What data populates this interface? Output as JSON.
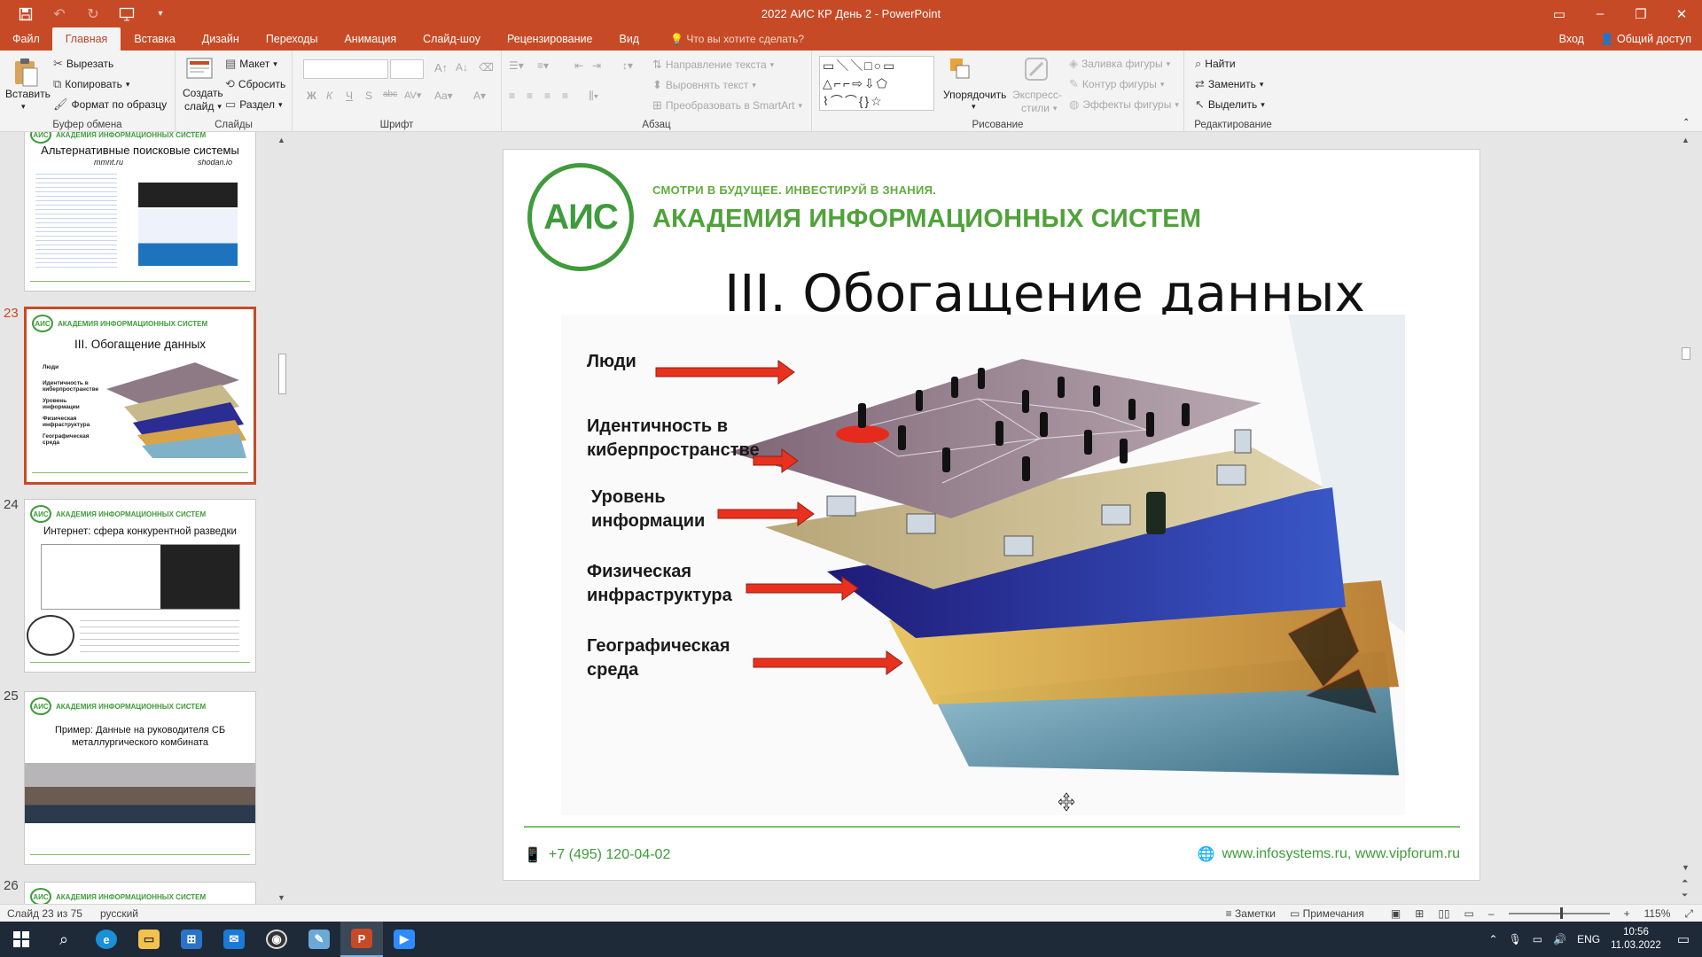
{
  "window": {
    "title": "2022 АИС КР День 2 - PowerPoint"
  },
  "tabs": [
    {
      "label": "Файл"
    },
    {
      "label": "Главная"
    },
    {
      "label": "Вставка"
    },
    {
      "label": "Дизайн"
    },
    {
      "label": "Переходы"
    },
    {
      "label": "Анимация"
    },
    {
      "label": "Слайд-шоу"
    },
    {
      "label": "Рецензирование"
    },
    {
      "label": "Вид"
    }
  ],
  "tell_me": "Что вы хотите сделать?",
  "account": {
    "signin": "Вход",
    "share": "Общий доступ"
  },
  "ribbon": {
    "clipboard": {
      "label": "Буфер обмена",
      "paste": "Вставить",
      "cut": "Вырезать",
      "copy": "Копировать",
      "format_painter": "Формат по образцу"
    },
    "slides": {
      "label": "Слайды",
      "new_slide_1": "Создать",
      "new_slide_2": "слайд",
      "layout": "Макет",
      "reset": "Сбросить",
      "section": "Раздел"
    },
    "font": {
      "label": "Шрифт",
      "font_name": "",
      "font_size": ""
    },
    "paragraph": {
      "label": "Абзац",
      "text_direction": "Направление текста",
      "align_text": "Выровнять текст",
      "smartart": "Преобразовать в SmartArt"
    },
    "drawing": {
      "label": "Рисование",
      "arrange": "Упорядочить",
      "quick_styles_1": "Экспресс-",
      "quick_styles_2": "стили",
      "shape_fill": "Заливка фигуры",
      "shape_outline": "Контур фигуры",
      "shape_effects": "Эффекты фигуры"
    },
    "editing": {
      "label": "Редактирование",
      "find": "Найти",
      "replace": "Заменить",
      "select": "Выделить"
    }
  },
  "thumbnails": [
    {
      "num": "",
      "title": "Альтернативные поисковые системы",
      "sub_left": "mmnt.ru",
      "sub_right": "shodan.io"
    },
    {
      "num": "23",
      "title": "III. Обогащение данных",
      "labels": [
        "Люди",
        "Идентичность в киберпространстве",
        "Уровень информации",
        "Физическая инфраструктура",
        "Географическая среда"
      ]
    },
    {
      "num": "24",
      "title": "Интернет: сфера конкурентной разведки"
    },
    {
      "num": "25",
      "title": "Пример: Данные на руководителя СБ металлургического комбината"
    },
    {
      "num": "26"
    }
  ],
  "slide": {
    "slogan": "СМОТРИ В БУДУЩЕЕ. ИНВЕСТИРУЙ В ЗНАНИЯ.",
    "academy": "АКАДЕМИЯ ИНФОРМАЦИОННЫХ СИСТЕМ",
    "logo_text": "АИС",
    "title": "III. Обогащение данных",
    "layers": [
      {
        "line1": "Люди",
        "line2": ""
      },
      {
        "line1": "Идентичность в",
        "line2": "киберпространстве"
      },
      {
        "line1": "Уровень",
        "line2": "информации"
      },
      {
        "line1": "Физическая",
        "line2": "инфраструктура"
      },
      {
        "line1": "Географическая",
        "line2": "среда"
      }
    ],
    "phone": "+7 (495) 120-04-02",
    "websites": "www.infosystems.ru, www.vipforum.ru"
  },
  "status": {
    "slide_info": "Слайд 23 из 75",
    "language": "русский",
    "notes": "Заметки",
    "comments": "Примечания",
    "zoom": "115%"
  },
  "taskbar": {
    "lang": "ENG",
    "time": "10:56",
    "date": "11.03.2022"
  },
  "colors": {
    "accent": "#c74a26",
    "brand_green": "#3f9b3b",
    "arrow_red": "#e8321e"
  }
}
